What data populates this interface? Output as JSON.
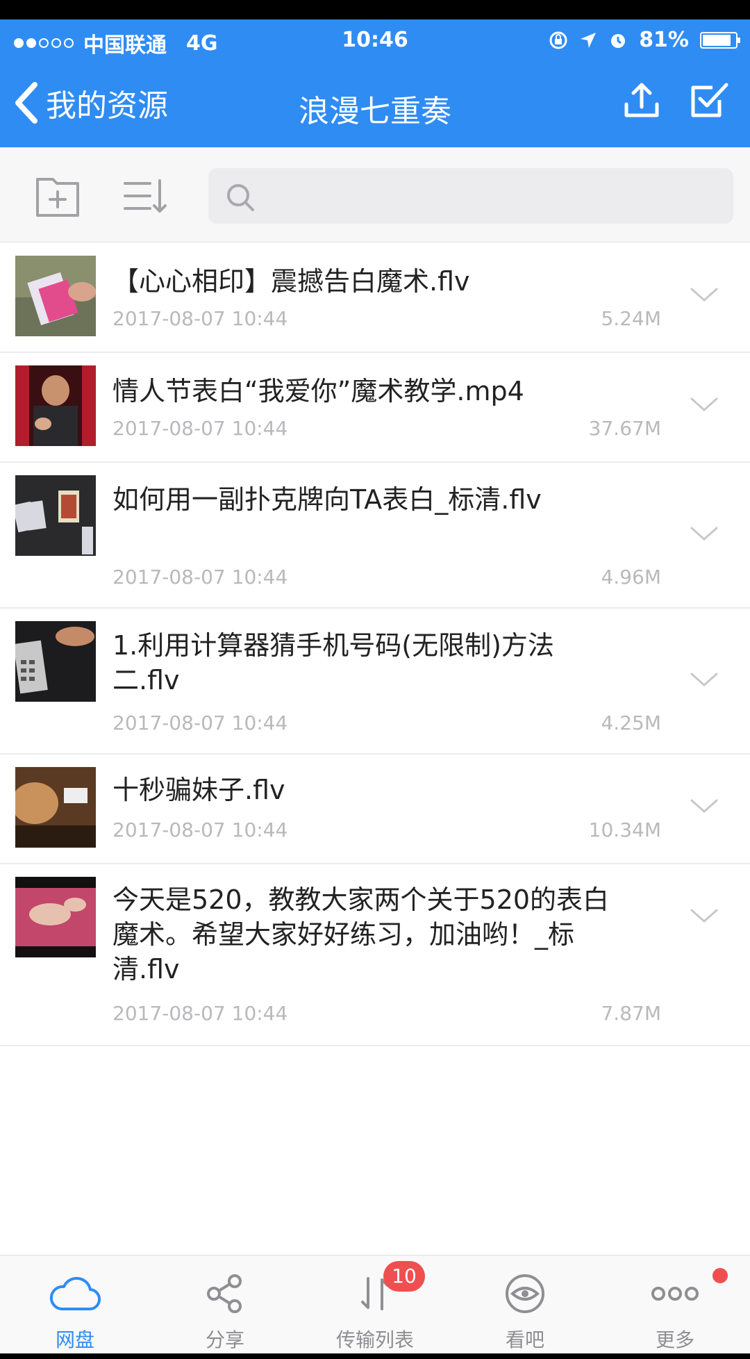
{
  "status_bar": {
    "carrier": "中国联通",
    "network": "4G",
    "time": "10:46",
    "battery": "81%"
  },
  "nav": {
    "back_label": "我的资源",
    "title": "浪漫七重奏"
  },
  "search": {
    "placeholder": ""
  },
  "files": [
    {
      "name": "【心心相印】震撼告白魔术.flv",
      "date": "2017-08-07 10:44",
      "size": "5.24M"
    },
    {
      "name": "情人节表白“我爱你”魔术教学.mp4",
      "date": "2017-08-07 10:44",
      "size": "37.67M"
    },
    {
      "name": "如何用一副扑克牌向TA表白_标清.flv",
      "date": "2017-08-07 10:44",
      "size": "4.96M"
    },
    {
      "name": "1.利用计算器猜手机号码(无限制)方法二.flv",
      "date": "2017-08-07 10:44",
      "size": "4.25M"
    },
    {
      "name": "十秒骗妹子.flv",
      "date": "2017-08-07 10:44",
      "size": "10.34M"
    },
    {
      "name": "今天是520，教教大家两个关于520的表白魔术。希望大家好好练习，加油哟！_标清.flv",
      "date": "2017-08-07 10:44",
      "size": "7.87M"
    }
  ],
  "tabs": [
    {
      "label": "网盘",
      "icon": "cloud-icon"
    },
    {
      "label": "分享",
      "icon": "share-icon"
    },
    {
      "label": "传输列表",
      "icon": "transfer-icon",
      "badge": "10"
    },
    {
      "label": "看吧",
      "icon": "eye-icon"
    },
    {
      "label": "更多",
      "icon": "more-icon"
    }
  ],
  "colors": {
    "accent": "#2f8cf3",
    "badge": "#ef4f4f"
  }
}
